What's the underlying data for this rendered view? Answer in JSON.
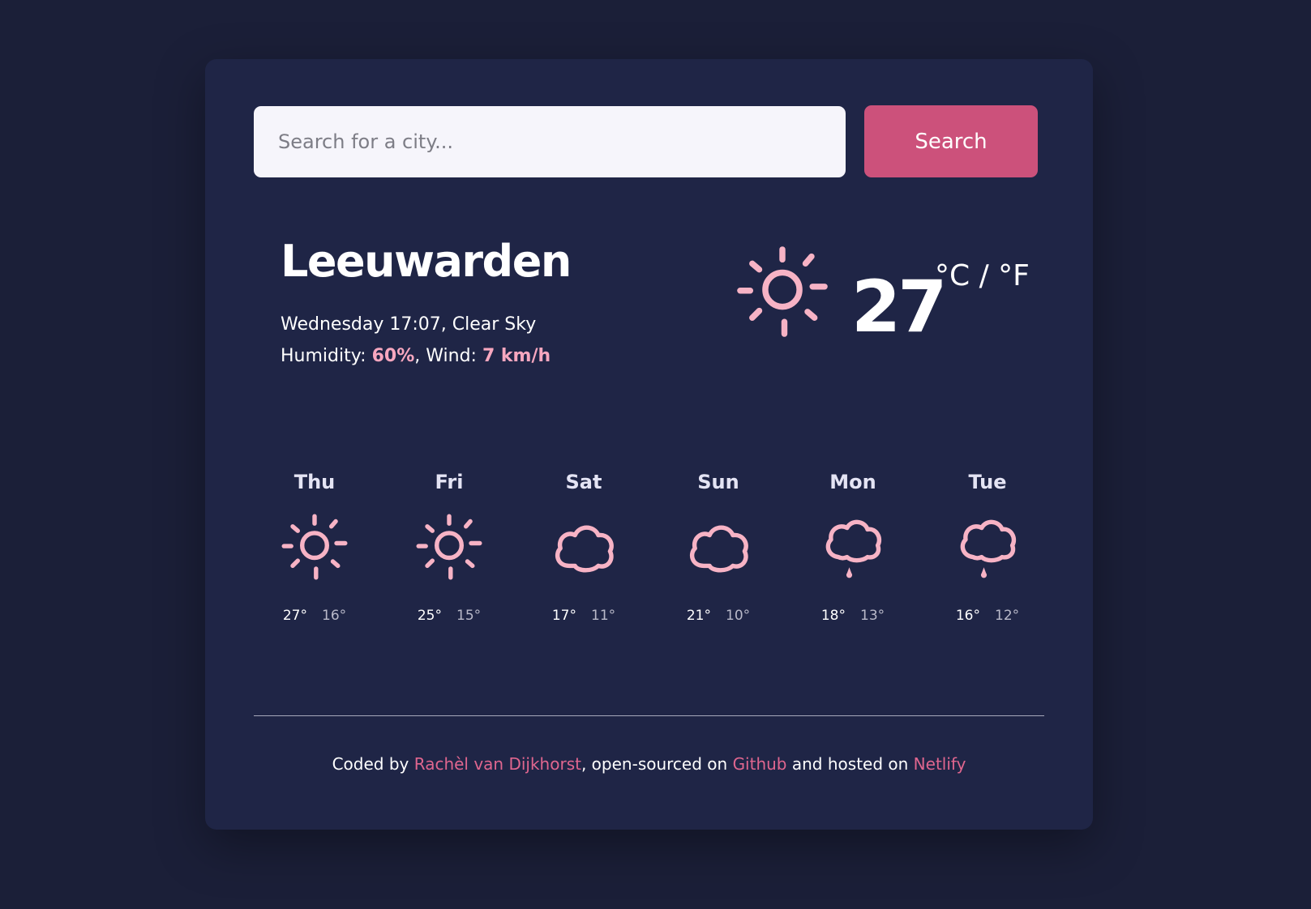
{
  "search": {
    "placeholder": "Search for a city...",
    "button_label": "Search"
  },
  "current": {
    "city": "Leeuwarden",
    "datetime": "Wednesday 17:07",
    "description": "Clear Sky",
    "humidity_label": "Humidity:",
    "humidity": "60%",
    "wind_label": "Wind:",
    "wind": "7 km/h",
    "temperature": "27",
    "units": "°C / °F",
    "icon": "sun-icon"
  },
  "forecast": [
    {
      "day": "Thu",
      "max": "27°",
      "min": "16°",
      "icon": "sun-icon"
    },
    {
      "day": "Fri",
      "max": "25°",
      "min": "15°",
      "icon": "sun-icon"
    },
    {
      "day": "Sat",
      "max": "17°",
      "min": "11°",
      "icon": "cloud-icon"
    },
    {
      "day": "Sun",
      "max": "21°",
      "min": "10°",
      "icon": "cloud-icon"
    },
    {
      "day": "Mon",
      "max": "18°",
      "min": "13°",
      "icon": "rain-cloud-icon"
    },
    {
      "day": "Tue",
      "max": "16°",
      "min": "12°",
      "icon": "rain-cloud-icon"
    }
  ],
  "footer": {
    "prefix": "Coded by ",
    "author": "Rachèl van Dijkhorst",
    "middle": ", open-sourced on ",
    "github": "Github",
    "middle2": " and hosted on ",
    "netlify": "Netlify"
  },
  "colors": {
    "background": "#1b1f38",
    "card": "#1f2546",
    "accent": "#cc517b",
    "highlight": "#f7a7bf",
    "icon": "#f7b3c5"
  }
}
